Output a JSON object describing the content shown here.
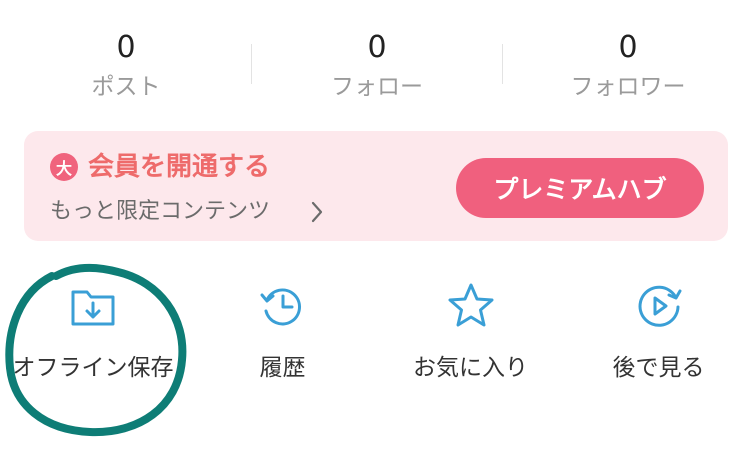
{
  "stats": [
    {
      "value": "0",
      "label": "ポスト"
    },
    {
      "value": "0",
      "label": "フォロー"
    },
    {
      "value": "0",
      "label": "フォロワー"
    }
  ],
  "banner": {
    "badge": "大",
    "title": "会員を開通する",
    "subtitle": "もっと限定コンテンツ",
    "button_label": "プレミアムハブ",
    "colors": {
      "title": "#ee6b6b",
      "button": "#f0607e",
      "background": "#fde8ec"
    }
  },
  "quick_actions": [
    {
      "label": "オフライン保存",
      "icon": "folder-download-icon"
    },
    {
      "label": "履歴",
      "icon": "history-clock-icon"
    },
    {
      "label": "お気に入り",
      "icon": "star-icon"
    },
    {
      "label": "後で見る",
      "icon": "play-later-icon"
    }
  ],
  "highlight_color": "#0e7d76"
}
